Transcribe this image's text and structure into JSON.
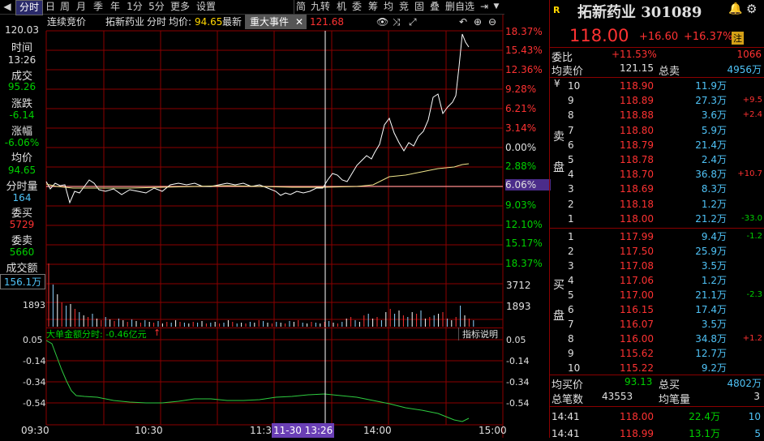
{
  "toolbar": {
    "tabs": [
      "分时",
      "日",
      "周",
      "月",
      "季",
      "年",
      "1分",
      "5分",
      "更多",
      "设置"
    ],
    "right_tabs": [
      "简",
      "九转",
      "机",
      "委",
      "筹",
      "均",
      "竞",
      "固",
      "叠",
      "删自选"
    ]
  },
  "info": {
    "auction": "连续竞价",
    "name": "拓新药业",
    "mode": "分时",
    "avg_label": "均价:",
    "avg_value": "94.65",
    "latest_label": "最新",
    "event_label": "重大事件",
    "price_tail": "121.68"
  },
  "left_panel": {
    "top_price": "120.03",
    "time_label": "时间",
    "time_value": "13:26",
    "deal_label": "成交",
    "deal_value": "95.26",
    "change_label": "涨跌",
    "change_value": "-6.14",
    "pct_label": "涨幅",
    "pct_value": "-6.06%",
    "avg_label": "均价",
    "avg_value": "94.65",
    "vol_label": "分时量",
    "vol_value": "164",
    "buy_label": "委买",
    "buy_value": "5729",
    "sell_label": "委卖",
    "sell_value": "5660",
    "amount_label": "成交额",
    "amount_value": "156.1万",
    "vol_axis": "1893"
  },
  "price_axis_pct": [
    "18.37%",
    "15.43%",
    "12.36%",
    "9.28%",
    "6.21%",
    "3.14%",
    "0.00%",
    "2.88%",
    "6.06%",
    "9.03%",
    "12.10%",
    "15.17%",
    "18.37%"
  ],
  "vol_axis_right": [
    "3712",
    "1893"
  ],
  "indicator": {
    "title": "大单金额分时: -0.46亿元",
    "arrow": "↑",
    "help": "指标说明",
    "axis": [
      "0.05",
      "-0.14",
      "-0.34",
      "-0.54"
    ]
  },
  "time_axis": [
    "09:30",
    "10:30",
    "11:3",
    "14:00",
    "15:00"
  ],
  "cursor_time": "11-30 13:26",
  "stock": {
    "logo": "R",
    "title": "拓新药业 301089",
    "price": "118.00",
    "change": "+16.60",
    "pct": "+16.37%",
    "tag": "注"
  },
  "ratio": {
    "wb_label": "委比",
    "wb_value": "+11.53%",
    "wb_count": "1066",
    "avg_sell_label": "均卖价",
    "avg_sell_value": "121.15",
    "total_sell_label": "总卖",
    "total_sell_value": "4956万"
  },
  "asks": [
    {
      "lvl": "10",
      "price": "118.90",
      "vol": "11.9万",
      "chg": ""
    },
    {
      "lvl": "9",
      "price": "118.89",
      "vol": "27.3万",
      "chg": "+9.5"
    },
    {
      "lvl": "8",
      "price": "118.88",
      "vol": "3.6万",
      "chg": "+2.4"
    },
    {
      "lvl": "7",
      "price": "118.80",
      "vol": "5.9万",
      "chg": ""
    },
    {
      "lvl": "6",
      "price": "118.79",
      "vol": "21.4万",
      "chg": ""
    },
    {
      "lvl": "5",
      "price": "118.78",
      "vol": "2.4万",
      "chg": ""
    },
    {
      "lvl": "4",
      "price": "118.70",
      "vol": "36.8万",
      "chg": "+10.7"
    },
    {
      "lvl": "3",
      "price": "118.69",
      "vol": "8.3万",
      "chg": ""
    },
    {
      "lvl": "2",
      "price": "118.18",
      "vol": "1.2万",
      "chg": ""
    },
    {
      "lvl": "1",
      "price": "118.00",
      "vol": "21.2万",
      "chg": "-33.0"
    }
  ],
  "bids": [
    {
      "lvl": "1",
      "price": "117.99",
      "vol": "9.4万",
      "chg": "-1.2"
    },
    {
      "lvl": "2",
      "price": "117.50",
      "vol": "25.9万",
      "chg": ""
    },
    {
      "lvl": "3",
      "price": "117.08",
      "vol": "3.5万",
      "chg": ""
    },
    {
      "lvl": "4",
      "price": "117.06",
      "vol": "1.2万",
      "chg": ""
    },
    {
      "lvl": "5",
      "price": "117.00",
      "vol": "21.1万",
      "chg": "-2.3"
    },
    {
      "lvl": "6",
      "price": "116.15",
      "vol": "17.4万",
      "chg": ""
    },
    {
      "lvl": "7",
      "price": "116.07",
      "vol": "3.5万",
      "chg": ""
    },
    {
      "lvl": "8",
      "price": "116.00",
      "vol": "34.8万",
      "chg": "+1.2"
    },
    {
      "lvl": "9",
      "price": "115.62",
      "vol": "12.7万",
      "chg": ""
    },
    {
      "lvl": "10",
      "price": "115.22",
      "vol": "9.2万",
      "chg": ""
    }
  ],
  "ask_side": [
    "卖",
    "盘"
  ],
  "bid_side": [
    "买",
    "盘"
  ],
  "yen": "¥",
  "bottom": {
    "avg_buy_label": "均买价",
    "avg_buy_value": "93.13",
    "total_buy_label": "总买",
    "total_buy_value": "4802万",
    "trades_label": "总笔数",
    "trades_value": "43553",
    "avg_lot_label": "均笔量",
    "avg_lot_value": "3"
  },
  "ticks": [
    {
      "time": "14:41",
      "price": "118.00",
      "vol": "22.4万",
      "n": "10"
    },
    {
      "time": "14:41",
      "price": "118.99",
      "vol": "13.1万",
      "n": "5"
    }
  ]
}
